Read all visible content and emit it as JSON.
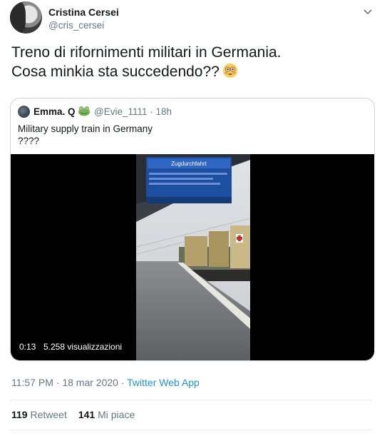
{
  "author": {
    "display_name": "Cristina Cersei",
    "handle": "@cris_cersei"
  },
  "tweet": {
    "line1": "Treno di rifornimenti militari in Germania.",
    "line2": "Cosa minkia sta succedendo??",
    "emoji": "flushed-face-emoji"
  },
  "quoted": {
    "display_name": "Emma. Q",
    "handle_time": "@Evie_1111 · 18h",
    "line1": "Military supply train in Germany",
    "line2": "????",
    "video": {
      "duration": "0:13",
      "views": "5.258 visualizzazioni",
      "board_title": "Zugdurchfahrt"
    }
  },
  "meta": {
    "timestamp": "11:57 PM · 18 mar 2020 · ",
    "source": "Twitter Web App"
  },
  "stats": {
    "retweets_count": "119",
    "retweets_label": " Retweet",
    "likes_count": "141",
    "likes_label": " Mi piace"
  },
  "colors": {
    "link": "#1b95e0",
    "secondary_text": "#657786",
    "border": "#ccd6dd"
  }
}
